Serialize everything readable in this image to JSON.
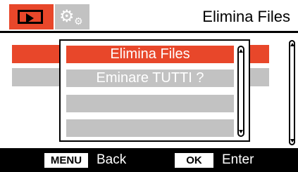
{
  "header": {
    "title": "Elimina Files",
    "tabs": [
      {
        "icon": "playback-icon",
        "active": true
      },
      {
        "icon": "settings-gears-icon",
        "active": false
      }
    ]
  },
  "dialog": {
    "options": [
      "Elimina Files",
      "Eminare TUTTI ?",
      "",
      ""
    ],
    "selected_index": 0
  },
  "footer": {
    "menu_key": "MENU",
    "menu_action": "Back",
    "ok_key": "OK",
    "ok_action": "Enter"
  },
  "colors": {
    "accent": "#e8472a",
    "inactive": "#c2c2c2",
    "background": "#ffffff",
    "bar": "#000000"
  }
}
